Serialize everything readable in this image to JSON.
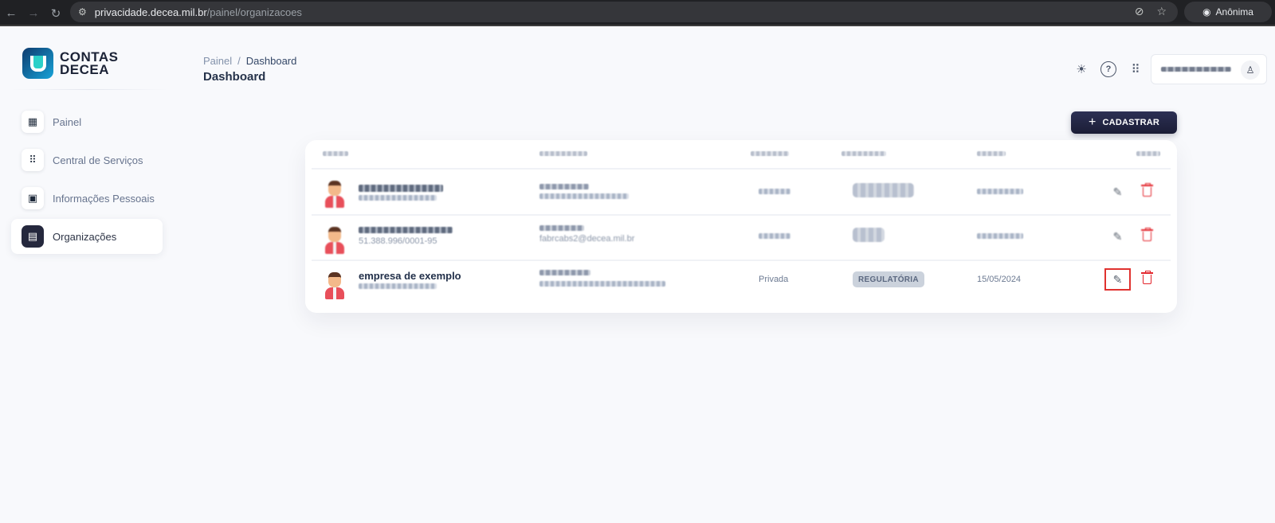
{
  "browser": {
    "back_icon": "arrow-left-icon",
    "forward_icon": "arrow-right-icon",
    "reload_icon": "reload-icon",
    "url_host": "privacidade.decea.mil.br",
    "url_path": "/painel/organizacoes",
    "profile_label": "Anônima"
  },
  "logo": {
    "line1": "CONTAS",
    "line2": "DECEA"
  },
  "sidebar": {
    "items": [
      {
        "label": "Painel",
        "icon": "grid-icon",
        "active": false
      },
      {
        "label": "Central de Serviços",
        "icon": "apps-icon",
        "active": false
      },
      {
        "label": "Informações Pessoais",
        "icon": "id-card-icon",
        "active": false
      },
      {
        "label": "Organizações",
        "icon": "building-icon",
        "active": true
      }
    ]
  },
  "header": {
    "breadcrumb_root": "Painel",
    "breadcrumb_sep": "/",
    "breadcrumb_current": "Dashboard",
    "title": "Dashboard"
  },
  "toolbar": {
    "register_plus": "+",
    "register_label": "CADASTRAR"
  },
  "table": {
    "rows": [
      {
        "name": "",
        "sub": "",
        "type": "",
        "tag": "",
        "date": "",
        "blurred": true
      },
      {
        "name": "",
        "sub": "51.388.996/0001-95",
        "email": "fabrcabs2@decea.mil.br",
        "type": "",
        "tag": "",
        "date": "",
        "blurred": true
      },
      {
        "name": "empresa de exemplo",
        "sub": "",
        "type": "Privada",
        "tag": "REGULATÓRIA",
        "date": "15/05/2024",
        "blurred": false
      }
    ]
  },
  "colors": {
    "accent": "#25283d",
    "danger": "#e3242b",
    "highlight": "#e0322f"
  }
}
